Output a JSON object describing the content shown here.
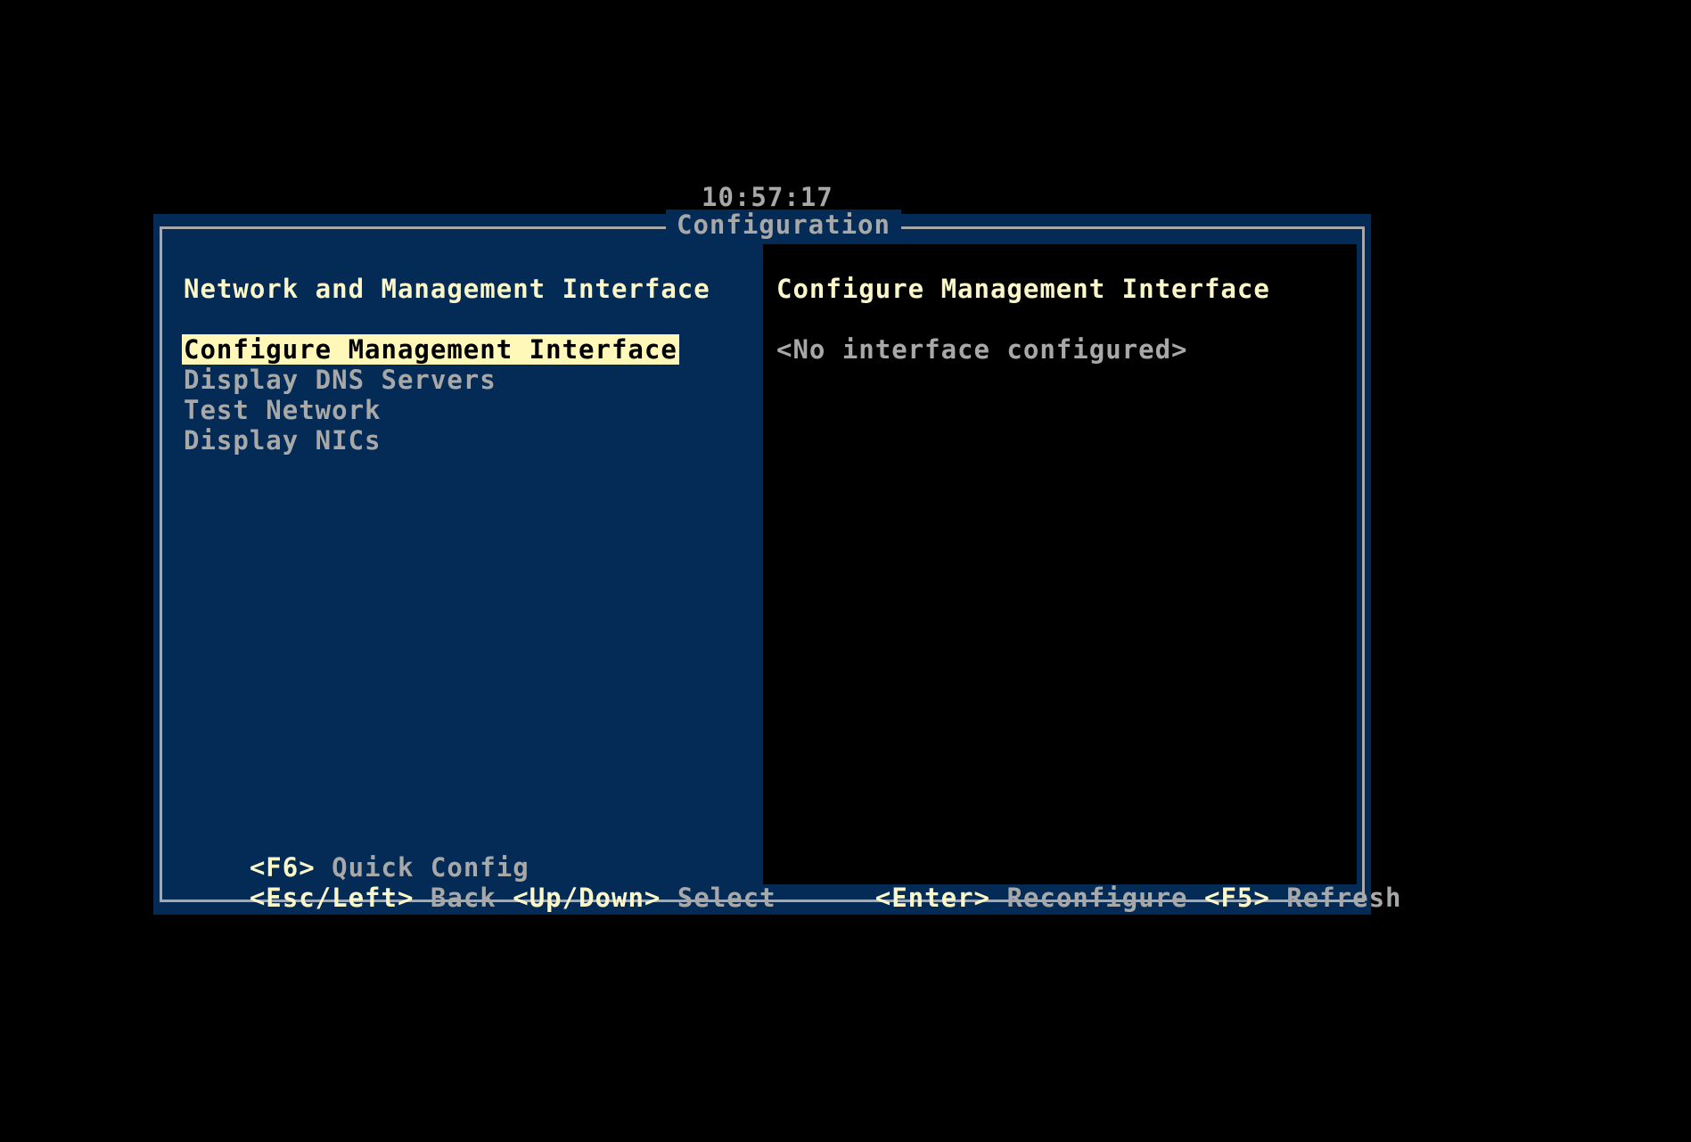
{
  "clock": "10:57:17",
  "window": {
    "title": "Configuration"
  },
  "left_pane": {
    "heading": "Network and Management Interface",
    "menu_items": [
      {
        "label": "Configure Management Interface",
        "selected": true
      },
      {
        "label": "Display DNS Servers",
        "selected": false
      },
      {
        "label": "Test Network",
        "selected": false
      },
      {
        "label": "Display NICs",
        "selected": false
      }
    ],
    "footer": {
      "line1": [
        {
          "key": "<F6>",
          "action": "Quick Config"
        }
      ],
      "line2": [
        {
          "key": "<Esc/Left>",
          "action": "Back"
        },
        {
          "key": "<Up/Down>",
          "action": "Select"
        }
      ]
    }
  },
  "right_pane": {
    "heading": "Configure Management Interface",
    "status": "<No interface configured>",
    "footer": [
      {
        "key": "<Enter>",
        "action": "Reconfigure"
      },
      {
        "key": "<F5>",
        "action": "Refresh"
      }
    ]
  },
  "colors": {
    "panel_background": "#032b55",
    "right_pane_background": "#000000",
    "heading_text": "#fbf7c8",
    "normal_text": "#a8a8a8",
    "selection_background": "#fff8b8"
  }
}
